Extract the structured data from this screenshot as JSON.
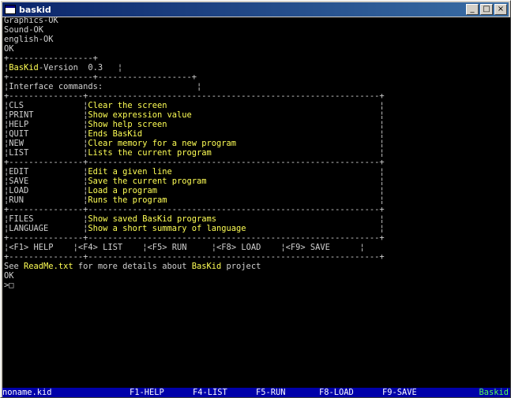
{
  "window": {
    "title": "baskid",
    "minimize_label": "_",
    "maximize_label": "□",
    "close_label": "×"
  },
  "boot": [
    "Graphics-OK",
    "Sound-OK",
    "english-OK",
    "OK"
  ],
  "version_box": {
    "border": "+-----------------+",
    "name": "BasKid",
    "version": "-Version  0.3"
  },
  "interface_box": {
    "border": "+-----------------+-------------------+",
    "label": "Interface commands:"
  },
  "table_border": "+---------------+-----------------------------------------------------------+",
  "groups": [
    [
      {
        "cmd": "CLS",
        "desc": "Clear the screen"
      },
      {
        "cmd": "PRINT",
        "desc": "Show expression value"
      },
      {
        "cmd": "HELP",
        "desc": "Show help screen"
      },
      {
        "cmd": "QUIT",
        "desc": "Ends BasKid"
      },
      {
        "cmd": "NEW",
        "desc": "Clear memory for a new program"
      },
      {
        "cmd": "LIST",
        "desc": "Lists the current program"
      }
    ],
    [
      {
        "cmd": "EDIT",
        "desc": "Edit a given line"
      },
      {
        "cmd": "SAVE",
        "desc": "Save the current program"
      },
      {
        "cmd": "LOAD",
        "desc": "Load a program"
      },
      {
        "cmd": "RUN",
        "desc": "Runs the program"
      }
    ],
    [
      {
        "cmd": "FILES",
        "desc": "Show saved BasKid programs"
      },
      {
        "cmd": "LANGUAGE",
        "desc": "Show a short summary of language"
      }
    ]
  ],
  "keys": [
    "<F1> HELP",
    "<F4> LIST",
    "<F5> RUN",
    "<F8> LOAD",
    "<F9> SAVE"
  ],
  "footer": {
    "see": "See ",
    "readme": "ReadMe.txt",
    "middle": " for more details about ",
    "brand": "BasKid",
    "end": " project"
  },
  "prompt_ok": "OK",
  "prompt": ">",
  "cursor": "□",
  "statusbar": {
    "filename": "noname.kid",
    "keys": [
      "F1-HELP",
      "F4-LIST",
      "F5-RUN",
      "F8-LOAD",
      "F9-SAVE"
    ],
    "brand": "Baskid"
  },
  "colors": {
    "console_bg": "#000000",
    "text": "#d0d0d0",
    "highlight": "#ffff55",
    "brand": "#55ff55",
    "statusbar_bg": "#0000aa",
    "titlebar": "#0a246a"
  }
}
